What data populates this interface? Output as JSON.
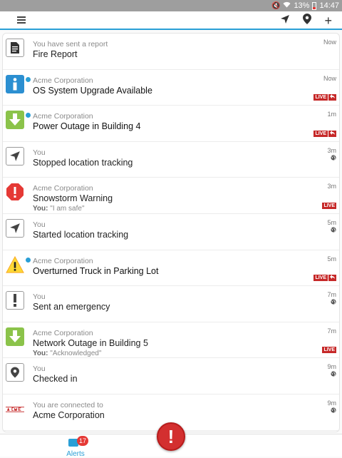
{
  "status_bar": {
    "battery": "13%",
    "time": "14:47"
  },
  "colors": {
    "accent": "#2a9fd6",
    "live": "#c62828",
    "sos": "#d32f2f"
  },
  "alerts": [
    {
      "sender": "You have sent a report",
      "title": "Fire Report",
      "time": "Now",
      "icon": "document-icon",
      "unread": false,
      "live": false,
      "globe": false,
      "reply_label": "",
      "reply": ""
    },
    {
      "sender": "Acme Corporation",
      "title": "OS System Upgrade Available",
      "time": "Now",
      "icon": "info-icon",
      "unread": true,
      "live": true,
      "live_arrow": true,
      "globe": false,
      "reply_label": "",
      "reply": ""
    },
    {
      "sender": "Acme Corporation",
      "title": "Power Outage in Building 4",
      "time": "1m",
      "icon": "down-arrow-icon",
      "unread": true,
      "live": true,
      "live_arrow": true,
      "globe": false,
      "reply_label": "",
      "reply": ""
    },
    {
      "sender": "You",
      "title": "Stopped location tracking",
      "time": "3m",
      "icon": "navigation-icon",
      "unread": false,
      "live": false,
      "globe": true,
      "reply_label": "",
      "reply": ""
    },
    {
      "sender": "Acme Corporation",
      "title": "Snowstorm Warning",
      "time": "3m",
      "icon": "stop-exclamation-icon",
      "unread": false,
      "live": true,
      "live_arrow": false,
      "globe": false,
      "reply_label": "You:",
      "reply": " \"I am safe\""
    },
    {
      "sender": "You",
      "title": "Started location tracking",
      "time": "5m",
      "icon": "navigation-icon",
      "unread": false,
      "live": false,
      "globe": true,
      "reply_label": "",
      "reply": ""
    },
    {
      "sender": "Acme Corporation",
      "title": "Overturned Truck in Parking Lot",
      "time": "5m",
      "icon": "warning-triangle-icon",
      "unread": true,
      "live": true,
      "live_arrow": true,
      "globe": false,
      "reply_label": "",
      "reply": ""
    },
    {
      "sender": "You",
      "title": "Sent an emergency",
      "time": "7m",
      "icon": "exclamation-icon",
      "unread": false,
      "live": false,
      "globe": true,
      "reply_label": "",
      "reply": ""
    },
    {
      "sender": "Acme Corporation",
      "title": "Network Outage in Building 5",
      "time": "7m",
      "icon": "down-arrow-icon",
      "unread": false,
      "live": true,
      "live_arrow": false,
      "globe": false,
      "reply_label": "You:",
      "reply": " \"Acknowledged\""
    },
    {
      "sender": "You",
      "title": "Checked in",
      "time": "9m",
      "icon": "location-pin-icon",
      "unread": false,
      "live": false,
      "globe": true,
      "reply_label": "",
      "reply": ""
    },
    {
      "sender": "You are connected to",
      "title": "Acme Corporation",
      "time": "9m",
      "icon": "acme-logo-icon",
      "unread": false,
      "live": false,
      "globe": true,
      "reply_label": "",
      "reply": ""
    }
  ],
  "live_label": "LIVE",
  "bottom_nav": {
    "alerts_label": "Alerts",
    "alerts_badge": "17"
  }
}
